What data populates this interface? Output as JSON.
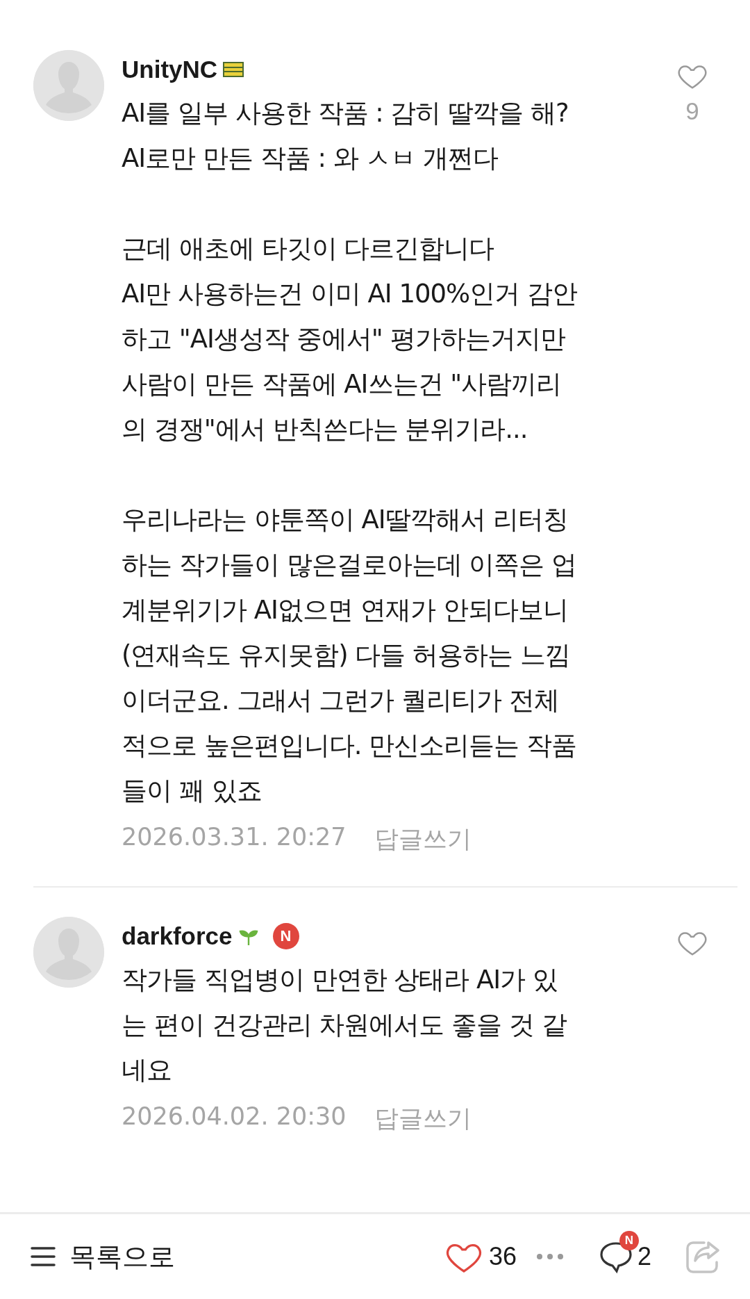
{
  "comments": [
    {
      "author": "UnityNC",
      "kind": "bars",
      "liked": false,
      "like_count": "9",
      "body": "AI를 일부 사용한 작품 : 감히 딸깍을 해?\nAI로만 만든 작품 : 와 ㅅㅂ 개쩐다\n\n근데 애초에 타깃이 다르긴합니다\nAI만 사용하는건 이미 AI 100%인거 감안\n하고 \"AI생성작 중에서\" 평가하는거지만\n사람이 만든 작품에 AI쓰는건 \"사람끼리\n의 경쟁\"에서 반칙쓴다는 분위기라...\n\n우리나라는 야툰쪽이 AI딸깍해서 리터칭\n하는 작가들이 많은걸로아는데 이쪽은 업\n계분위기가 AI없으면 연재가 안되다보니\n(연재속도 유지못함) 다들 허용하는 느낌\n이더군요. 그래서 그런가 퀄리티가 전체\n적으로 높은편입니다. 만신소리듣는 작품\n들이 꽤 있죠",
      "date": "2026.03.31. 20:27",
      "reply": "답글쓰기"
    },
    {
      "author": "darkforce",
      "kind": "sprout",
      "badge": "N",
      "liked": false,
      "body": "작가들 직업병이 만연한 상태라 AI가 있\n는 편이 건강관리 차원에서도 좋을 것 같\n네요",
      "date": "2026.04.02. 20:30",
      "reply": "답글쓰기"
    }
  ],
  "bottom_bar": {
    "list_label": "목록으로",
    "liked": true,
    "like_count": "36",
    "comment_badge": "N",
    "comment_count": "2",
    "share_disabled": true
  }
}
